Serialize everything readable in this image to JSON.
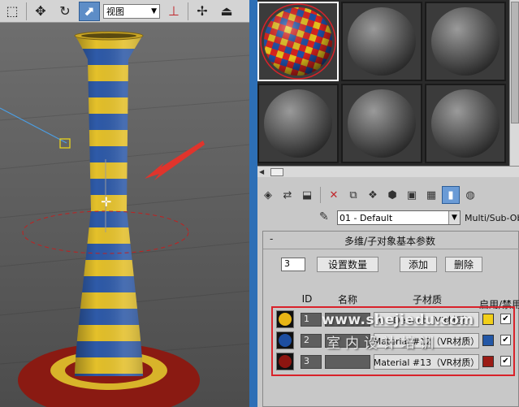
{
  "viewport": {
    "view_dropdown": "视图",
    "toolbar_icons": [
      "select-region-icon",
      "move-icon",
      "rotate-icon",
      "scale-icon",
      "snap-icon",
      "pan-view-icon",
      "maximize-icon"
    ]
  },
  "material_editor": {
    "slots": [
      {
        "type": "checker",
        "selected": true
      },
      {
        "type": "gray"
      },
      {
        "type": "gray"
      },
      {
        "type": "gray"
      },
      {
        "type": "gray"
      },
      {
        "type": "gray"
      }
    ],
    "material_name": "01 - Default",
    "material_type": "Multi/Sub-Obj",
    "rollout": {
      "collapse": "-",
      "title": "多维/子对象基本参数",
      "count": "3",
      "set_count_label": "设置数量",
      "add_label": "添加",
      "delete_label": "删除",
      "headers": {
        "id": "ID",
        "name": "名称",
        "submaterial": "子材质",
        "enable": "启用/禁用"
      },
      "rows": [
        {
          "id": "1",
          "name": "",
          "submaterial": "0 - Default（VR材质）",
          "color": "#f2cf19",
          "ball": "#e8b515",
          "enabled": true
        },
        {
          "id": "2",
          "name": "",
          "submaterial": "Material #12（VR材质）",
          "color": "#2357a6",
          "ball": "#1d4ea0",
          "enabled": true
        },
        {
          "id": "3",
          "name": "",
          "submaterial": "Material #13（VR材质）",
          "color": "#9b1b15",
          "ball": "#8c1510",
          "enabled": true
        }
      ]
    }
  },
  "watermark": {
    "line1": "www.shejiedu.com",
    "line2": "室内设计培训"
  },
  "colors": {
    "accent_blue": "#2d6fb6",
    "selection_red": "#d9222a",
    "yellow": "#f2cf19",
    "blue": "#2357a6",
    "red": "#9b1b15"
  }
}
